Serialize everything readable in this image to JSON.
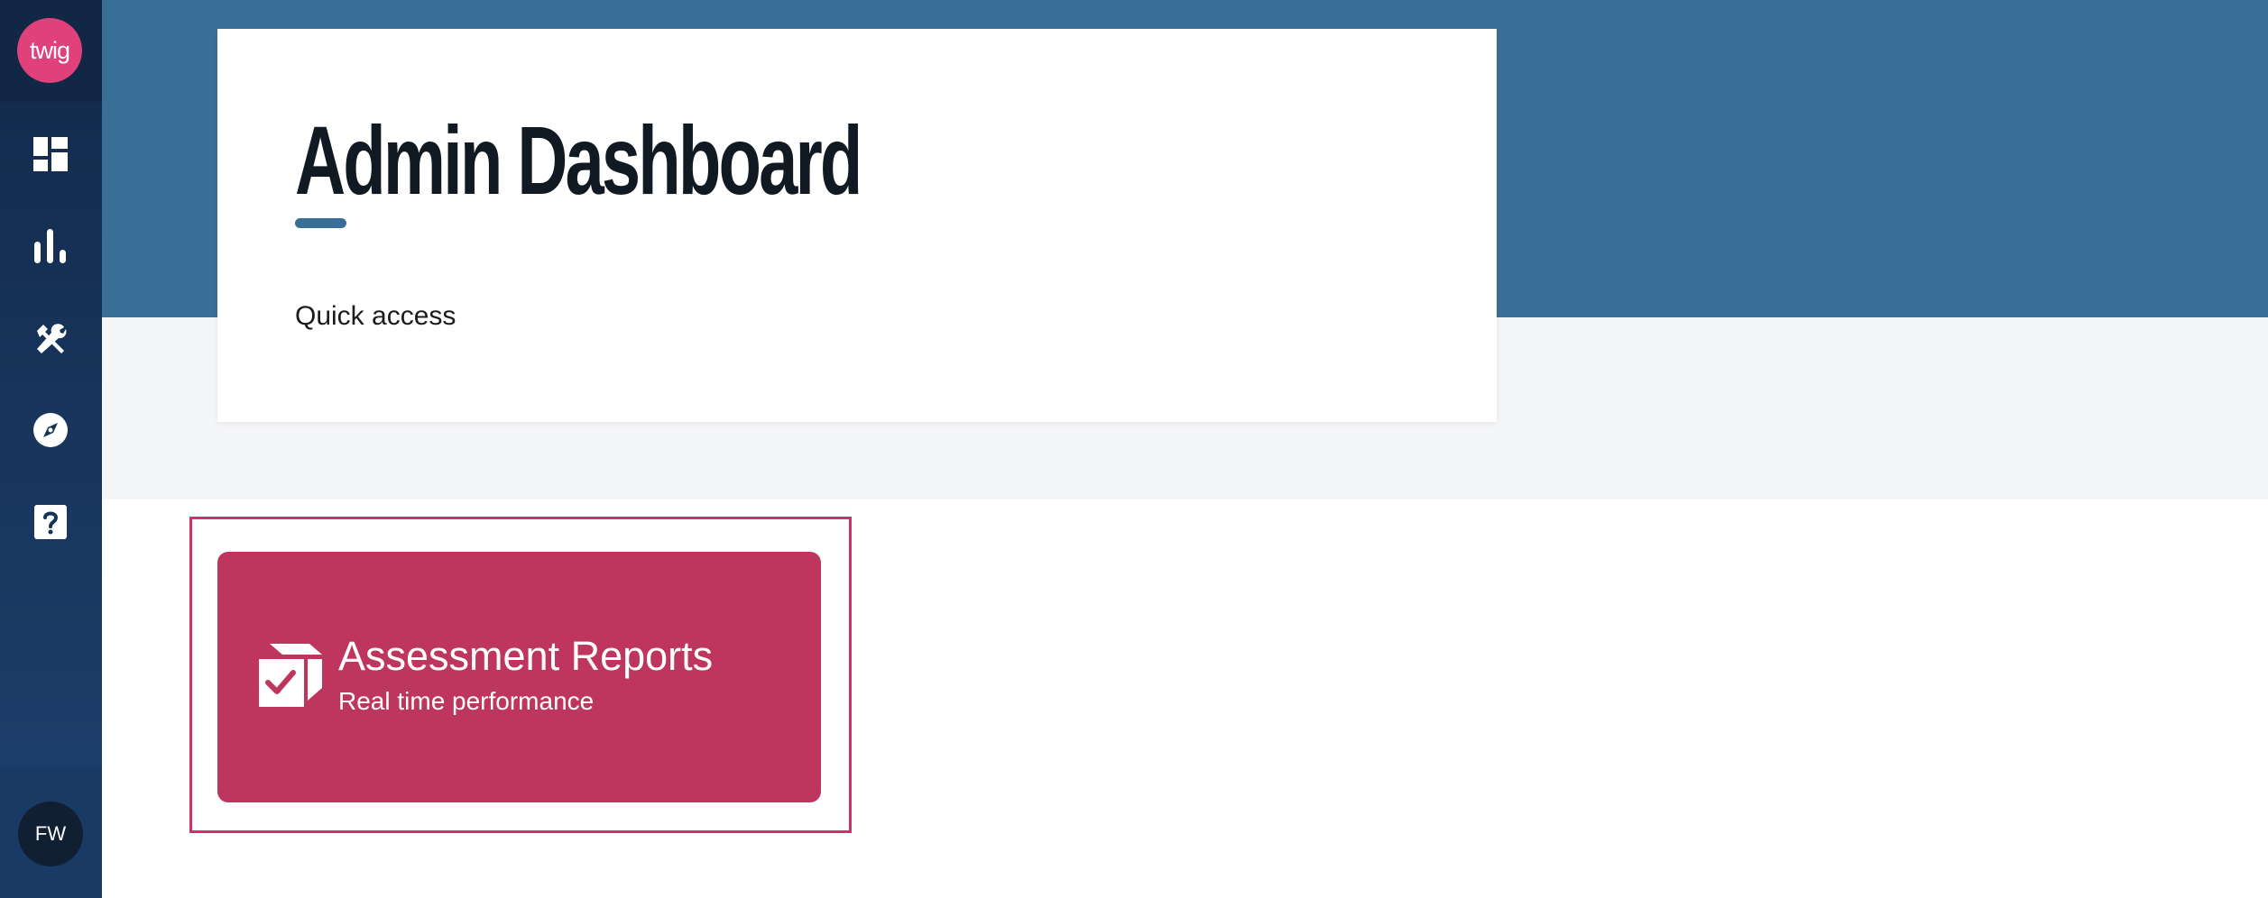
{
  "sidebar": {
    "logo_text": "twig",
    "nav_items": [
      {
        "icon": "dashboard-icon"
      },
      {
        "icon": "bar-chart-icon"
      },
      {
        "icon": "tools-icon"
      },
      {
        "icon": "compass-icon"
      },
      {
        "icon": "help-icon"
      }
    ],
    "avatar_initials": "FW"
  },
  "header": {
    "title": "Admin Dashboard",
    "section_label": "Quick access"
  },
  "quick_access": {
    "cards": [
      {
        "title": "Assessment Reports",
        "subtitle": "Real time performance",
        "icon": "box-check-icon"
      }
    ]
  },
  "colors": {
    "sidebar": "#12294a",
    "brand_pink": "#e0417a",
    "hero": "#396f97",
    "card": "#be355d",
    "focus": "#d2306d",
    "grey_band": "#f4f5f7"
  }
}
